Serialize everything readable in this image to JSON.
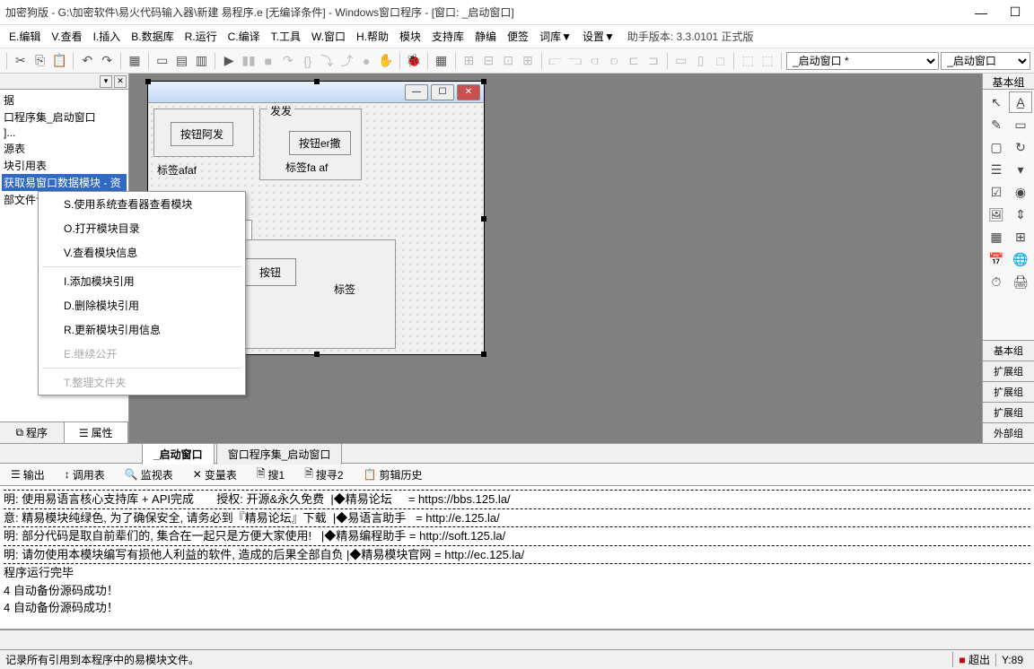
{
  "title": "加密狗版 - G:\\加密软件\\易火代码输入器\\新建 易程序.e [无编译条件] - Windows窗口程序 - [窗口: _启动窗口]",
  "menu": {
    "items": [
      "E.编辑",
      "V.查看",
      "I.插入",
      "B.数据库",
      "R.运行",
      "C.编译",
      "T.工具",
      "W.窗口",
      "H.帮助",
      "模块",
      "支持库",
      "静编",
      "便签",
      "词库▼",
      "设置▼"
    ],
    "version": "助手版本: 3.3.0101 正式版"
  },
  "toolbar_combo1": "_启动窗口 *",
  "toolbar_combo2": "_启动窗口",
  "tree": {
    "items": [
      "据",
      "口程序集_启动窗口",
      "]...",
      "源表",
      "块引用表",
      "获取易窗口数据模块 - 资",
      "部文件记"
    ]
  },
  "left_tabs": {
    "program": "程序",
    "properties": "属性"
  },
  "context_menu": {
    "items": [
      {
        "label": "S.使用系统查看器查看模块",
        "enabled": true
      },
      {
        "label": "O.打开模块目录",
        "enabled": true
      },
      {
        "label": "V.查看模块信息",
        "enabled": true
      },
      {
        "sep": true
      },
      {
        "label": "I.添加模块引用",
        "enabled": true
      },
      {
        "label": "D.删除模块引用",
        "enabled": true
      },
      {
        "label": "R.更新模块引用信息",
        "enabled": true
      },
      {
        "label": "E.继续公开",
        "enabled": false
      },
      {
        "sep": true
      },
      {
        "label": "T.整理文件夹",
        "enabled": false
      }
    ]
  },
  "form": {
    "frame1_title": "发发",
    "btn1": "按钮阿发",
    "btn2": "按钮er撒",
    "label1": "标签afaf",
    "label2": "标签fa af",
    "btn3": "按钮",
    "label3": "标签"
  },
  "bottom_tabs": {
    "tab1": "_启动窗口",
    "tab2": "窗口程序集_启动窗口"
  },
  "output_toolbar": {
    "tabs": [
      "输出",
      "调用表",
      "监视表",
      "变量表",
      "搜1",
      "搜寻2",
      "剪辑历史"
    ]
  },
  "right_panel": {
    "header": "基本组",
    "tabs": [
      "基本组",
      "扩展组",
      "扩展组",
      "扩展组",
      "外部组"
    ]
  },
  "output": {
    "lines": [
      "明: 使用易语言核心支持库 + API完成       授权: 开源&永久免费  |◆精易论坛     = https://bbs.125.la/",
      "意: 精易模块纯绿色, 为了确保安全, 请务必到『精易论坛』下载  |◆易语言助手   = http://e.125.la/",
      "明: 部分代码是取自前辈们的, 集合在一起只是方便大家使用!   |◆精易编程助手 = http://soft.125.la/",
      "明: 请勿使用本模块编写有损他人利益的软件, 造成的后果全部自负 |◆精易模块官网 = http://ec.125.la/",
      "",
      "程序运行完毕",
      "4 自动备份源码成功！",
      "4 自动备份源码成功！"
    ]
  },
  "status": {
    "text": "记录所有引用到本程序中的易模块文件。",
    "overflow": "超出",
    "pos": "Y:89"
  }
}
